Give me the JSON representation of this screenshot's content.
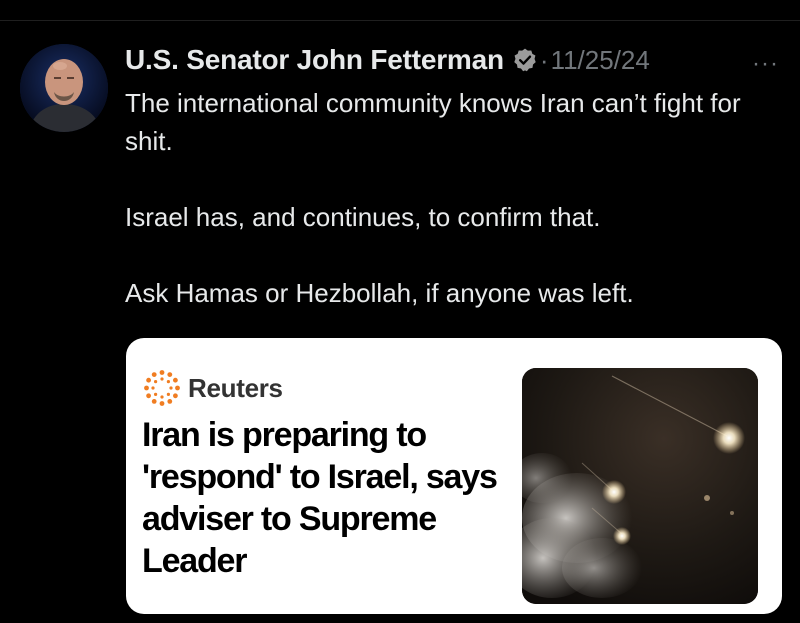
{
  "tweet": {
    "author": "U.S. Senator John Fetterman",
    "separator": "·",
    "date": "11/25/24",
    "more": "···",
    "paragraphs": [
      "The international community knows Iran can’t fight for shit.",
      "Israel has, and continues, to confirm that.",
      "Ask Hamas or Hezbollah, if anyone was left."
    ]
  },
  "card": {
    "source": "Reuters",
    "headline": "Iran is preparing to 'respond' to Israel, says adviser to Supreme Leader"
  },
  "colors": {
    "background": "#000000",
    "text": "#e7e9ea",
    "muted": "#71767b",
    "verified": "#9b9b9b",
    "reuters_orange": "#f07d22"
  },
  "icons": {
    "verified": "verified-badge-icon",
    "more": "more-options-icon",
    "reuters": "reuters-logo-icon"
  }
}
